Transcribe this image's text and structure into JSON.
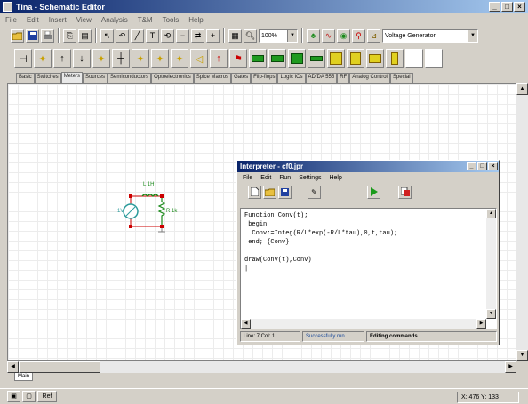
{
  "window": {
    "title": "Tina - Schematic Editor",
    "controls": [
      "_",
      "□",
      "×"
    ]
  },
  "menu": [
    "File",
    "Edit",
    "Insert",
    "View",
    "Analysis",
    "T&M",
    "Tools",
    "Help"
  ],
  "toolbar": {
    "zoom": "100%",
    "component_select": "Voltage Generator"
  },
  "component_tabs": [
    "Basic",
    "Switches",
    "Meters",
    "Sources",
    "Semiconductors",
    "Optoelectronics",
    "Spice Macros",
    "Gates",
    "Flip-flops",
    "Logic ICs",
    "AD/DA 555",
    "RF",
    "Analog Control",
    "Special"
  ],
  "active_tab_index": 2,
  "schematic": {
    "inductor_label": "L 1H",
    "resistor_label": "R 1k",
    "source_label": "1V"
  },
  "sheet_tab": "Main",
  "status_buttons": [
    "Ref"
  ],
  "coords": "X: 476 Y: 133",
  "interpreter": {
    "title": "Interpreter - cf0.jpr",
    "controls": [
      "_",
      "□",
      "×"
    ],
    "menu": [
      "File",
      "Edit",
      "Run",
      "Settings",
      "Help"
    ],
    "code": "Function Conv(t);\n begin\n  Conv:=Integ(R/L*exp(-R/L*tau),0,t,tau);\n end; {Conv}\n\ndraw(Conv(t),Conv)\n|",
    "status": {
      "position": "Line: 7 Col: 1",
      "message": "Successfully run",
      "mode": "Editing commands"
    }
  }
}
